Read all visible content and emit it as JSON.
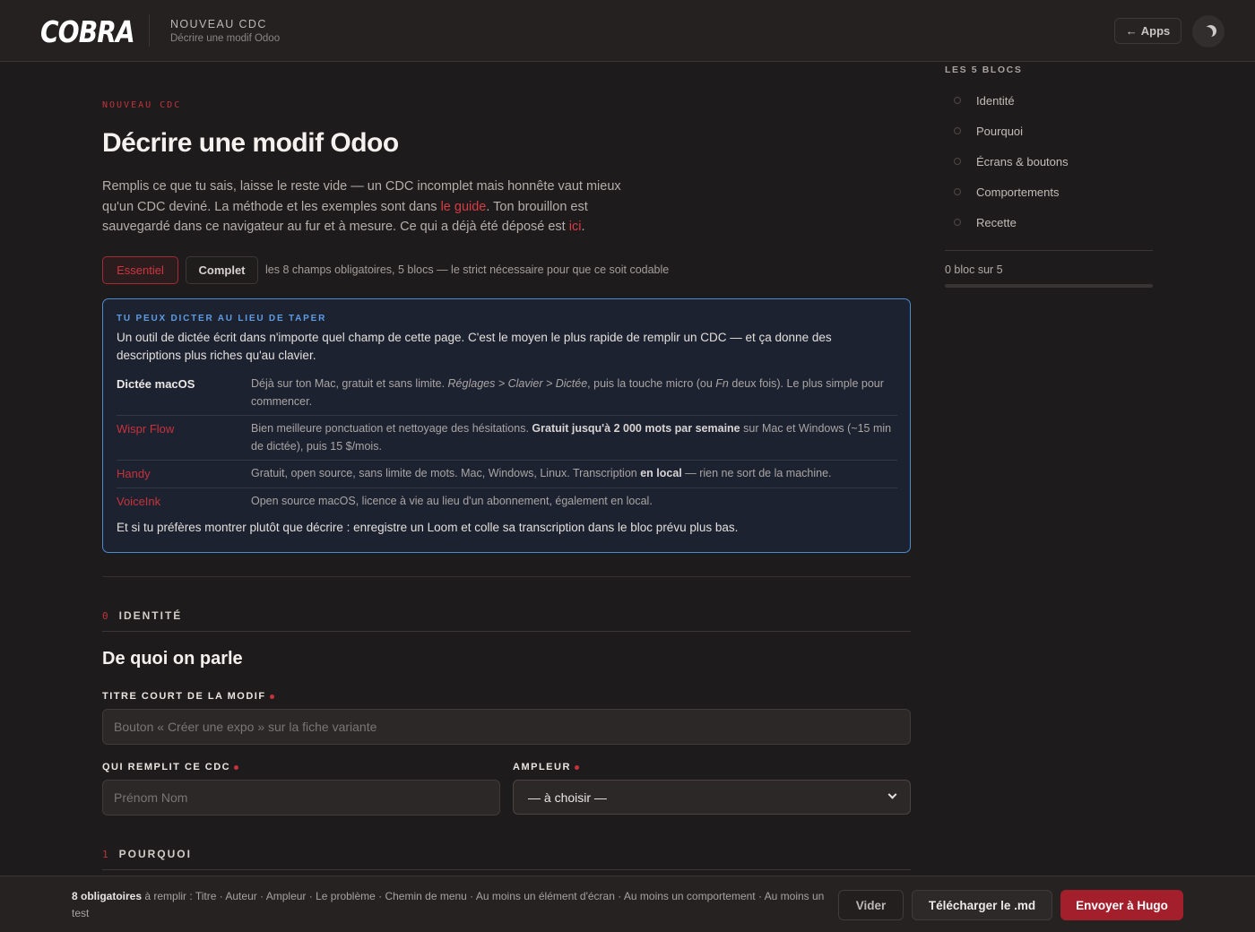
{
  "header": {
    "logo": "COBRA",
    "title": "NOUVEAU CDC",
    "subtitle": "Décrire une modif Odoo",
    "apps_label": "Apps",
    "apps_icon": "arrow-left-icon",
    "theme_icon": "moon-icon"
  },
  "main": {
    "eyebrow": "NOUVEAU CDC",
    "title": "Décrire une modif Odoo",
    "intro": {
      "p1": "Remplis ce que tu sais, laisse le reste vide — un CDC incomplet mais honnête vaut mieux qu'un CDC deviné. La méthode et les exemples sont dans ",
      "guide_link": "le guide",
      "p2": ". Ton brouillon est sauvegardé dans ce navigateur au fur et à mesure. Ce qui a déjà été déposé est ",
      "ici_link": "ici",
      "p3": "."
    },
    "modes": {
      "essentiel": "Essentiel",
      "complet": "Complet",
      "description": "les 8 champs obligatoires, 5 blocs — le strict nécessaire pour que ce soit codable"
    },
    "dictation": {
      "eyebrow": "TU PEUX DICTER AU LIEU DE TAPER",
      "intro": "Un outil de dictée écrit dans n'importe quel champ de cette page. C'est le moyen le plus rapide de remplir un CDC — et ça donne des descriptions plus riches qu'au clavier.",
      "tools": [
        {
          "name": "Dictée macOS",
          "desc_a": "Déjà sur ton Mac, gratuit et sans limite. ",
          "desc_i1": "Réglages > Clavier > Dictée",
          "desc_b": ", puis la touche micro (ou ",
          "desc_i2": "Fn",
          "desc_c": " deux fois). Le plus simple pour commencer."
        },
        {
          "name": "Wispr Flow",
          "desc_a": "Bien meilleure ponctuation et nettoyage des hésitations. ",
          "desc_bold": "Gratuit jusqu'à 2 000 mots par semaine",
          "desc_b": " sur Mac et Windows (~15 min de dictée), puis 15 $/mois."
        },
        {
          "name": "Handy",
          "desc_a": "Gratuit, open source, sans limite de mots. Mac, Windows, Linux. Transcription ",
          "desc_bold": "en local",
          "desc_b": " — rien ne sort de la machine."
        },
        {
          "name": "VoiceInk",
          "desc_a": "Open source macOS, licence à vie au lieu d'un abonnement, également en local."
        }
      ],
      "outro": "Et si tu préfères montrer plutôt que décrire : enregistre un Loom et colle sa transcription dans le bloc prévu plus bas."
    },
    "sections": {
      "identite": {
        "num": "0",
        "label": "IDENTITÉ",
        "title": "De quoi on parle"
      },
      "pourquoi": {
        "num": "1",
        "label": "POURQUOI"
      }
    },
    "fields": {
      "titre": {
        "label": "TITRE COURT DE LA MODIF",
        "placeholder": "Bouton « Créer une expo » sur la fiche variante"
      },
      "auteur": {
        "label": "QUI REMPLIT CE CDC",
        "placeholder": "Prénom Nom"
      },
      "ampleur": {
        "label": "AMPLEUR",
        "value": "— à choisir —"
      }
    }
  },
  "sidebar": {
    "title": "LES 5 BLOCS",
    "items": [
      {
        "label": "Identité"
      },
      {
        "label": "Pourquoi"
      },
      {
        "label": "Écrans & boutons"
      },
      {
        "label": "Comportements"
      },
      {
        "label": "Recette"
      }
    ],
    "progress_text": "0 bloc sur 5",
    "progress_fraction": 0
  },
  "footer": {
    "count": "8 obligatoires",
    "rest": " à remplir : Titre · Auteur · Ampleur · Le problème · Chemin de menu · Au moins un élément d'écran · Au moins un comportement · Au moins un test",
    "vider": "Vider",
    "download": "Télécharger le .md",
    "send": "Envoyer à Hugo"
  },
  "colors": {
    "accent": "#c3333e",
    "info_border": "#4b8bd0",
    "background": "#1d1b1b"
  }
}
